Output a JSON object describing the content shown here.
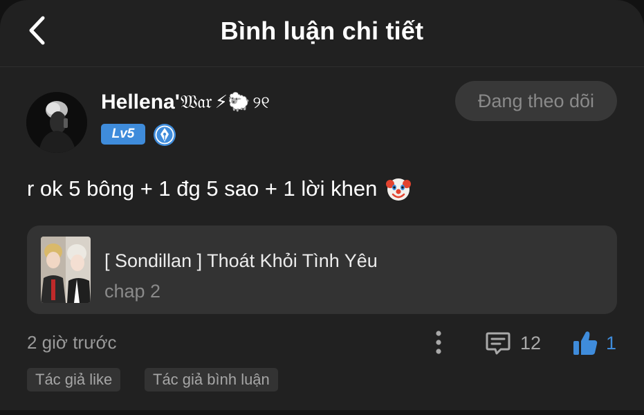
{
  "header": {
    "title": "Bình luận chi tiết",
    "back_icon": "chevron-left-icon"
  },
  "author": {
    "name": "Hellena'",
    "name_gothic": "𝔚𝔞𝔯",
    "name_emoji": "⚡🐑",
    "name_tail": "୨୧",
    "level": "Lv5",
    "verified_icon": "pen-nib-badge-icon",
    "follow_label": "Đang theo dõi"
  },
  "comment": {
    "text": "r ok 5 bông + 1 đg 5 sao + 1 lời khen",
    "emoji_icon": "clown-face-icon"
  },
  "story": {
    "title": "[ Sondillan ] Thoát Khỏi Tình Yêu",
    "chapter": "chap 2"
  },
  "meta": {
    "timestamp": "2 giờ trước",
    "reply_count": "12",
    "like_count": "1",
    "more_icon": "more-vertical-icon",
    "reply_icon": "comment-icon",
    "like_icon": "thumbs-up-icon"
  },
  "tags": {
    "author_liked": "Tác giả like",
    "author_commented": "Tác giả bình luận"
  },
  "colors": {
    "background": "#212121",
    "accent": "#3f8cdb",
    "card": "#333333",
    "muted_text": "#9a9a9a"
  }
}
